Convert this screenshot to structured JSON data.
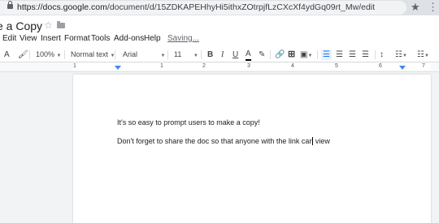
{
  "browser": {
    "url_host": "https://docs.google.com",
    "url_path": "/document/d/15ZDKAPEHhyHi5ithxZOtrpjfLzCXcXf4ydGq09rt_Mw/edit"
  },
  "doc": {
    "title": "e a Copy",
    "status": "Saving..."
  },
  "menu": [
    "Edit",
    "View",
    "Insert",
    "Format",
    "Tools",
    "Add-ons",
    "Help"
  ],
  "toolbar": {
    "zoom": "100%",
    "style": "Normal text",
    "font": "Arial",
    "size": "11",
    "bold": "B",
    "italic": "I",
    "underline": "U",
    "text_color": "A"
  },
  "ruler": {
    "numbers": [
      "1",
      "1",
      "2",
      "3",
      "4",
      "5",
      "6",
      "7"
    ]
  },
  "content": {
    "line1": "It's so easy to prompt users to make a copy!",
    "line2": "Don't forget to share the doc so that anyone with the link can view"
  }
}
